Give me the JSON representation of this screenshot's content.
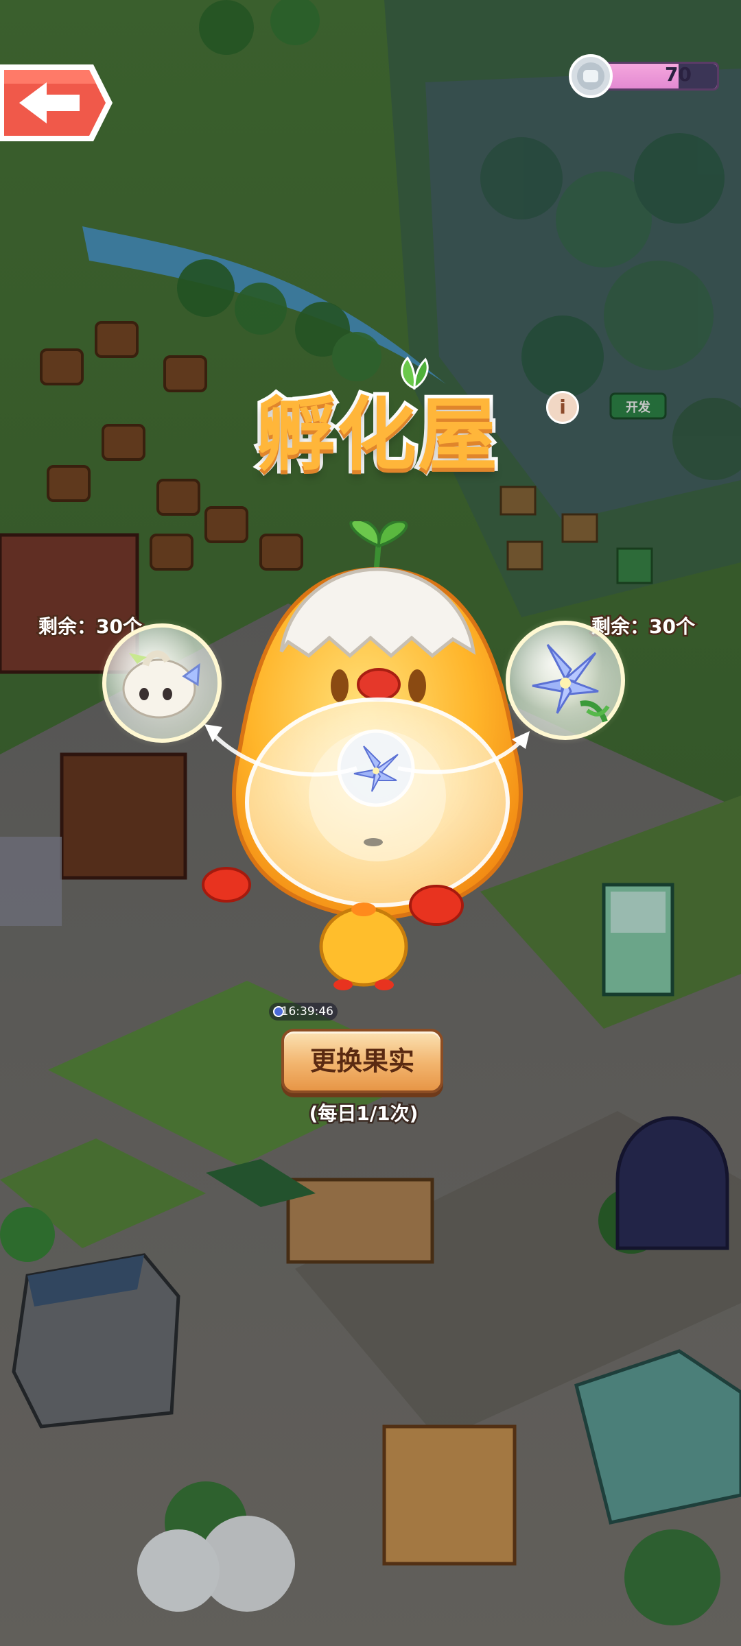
{
  "header": {
    "back_label": "back",
    "currency": {
      "amount": "70",
      "icon": "silver-coin-icon"
    }
  },
  "panel": {
    "title": "孵化屋",
    "info_icon_text": "i",
    "left_slot": {
      "remaining": "剩余：30个",
      "item": "white-fluffy-creature"
    },
    "right_slot": {
      "remaining": "剩余：30个",
      "item": "blue-lily-flower"
    },
    "timer": "16:39:46",
    "swap_button": "更换果实",
    "daily_limit": "(每日1/1次)"
  },
  "background": {
    "sign_dev": "开发"
  },
  "colors": {
    "title_orange": "#ffb63a",
    "button_gold": "#f2b46d",
    "grass": "#4f7a3a",
    "pavement": "#7b7f7a"
  }
}
